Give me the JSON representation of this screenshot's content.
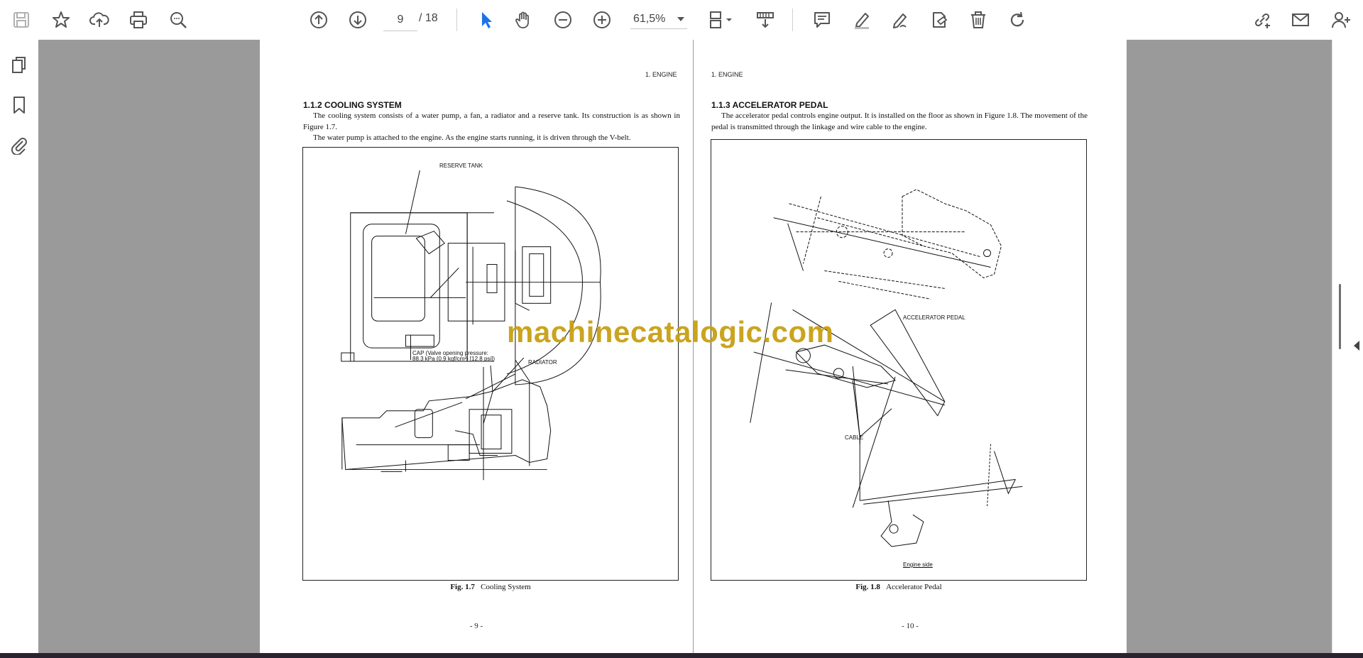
{
  "toolbar": {
    "current_page": "9",
    "page_total": "/ 18",
    "zoom": "61,5%",
    "buttons": [
      "save-icon",
      "bookmark-star-icon",
      "upload-cloud-icon",
      "print-icon",
      "zoom-search-icon",
      "previous-page-icon",
      "next-page-icon",
      "select-cursor-icon",
      "hand-pan-icon",
      "zoom-out-icon",
      "zoom-in-icon",
      "page-fit-icon",
      "scroll-mode-icon",
      "comment-icon",
      "highlight-pen-icon",
      "draw-pen-icon",
      "stamp-tag-icon",
      "delete-icon",
      "redo-icon",
      "share-link-icon",
      "email-icon",
      "add-user-icon"
    ],
    "accent": "#1a73e8"
  },
  "left_rail": {
    "items": [
      "pages-icon",
      "bookmarks-icon",
      "attachments-icon"
    ]
  },
  "watermark": "machinecatalogic.com",
  "pages": [
    {
      "header": "1.  ENGINE",
      "title": "1.1.2  COOLING SYSTEM",
      "para1": "The cooling system consists of a water pump, a fan, a radiator and a reserve tank.  Its construction is as shown in Figure 1.7.",
      "para2": "The water pump is attached to the engine.  As the engine starts running, it is driven through the V-belt.",
      "labels": {
        "reserve_tank": "RESERVE TANK",
        "cap_line1": "CAP (Valve opening pressure:",
        "cap_line2": "88.3 kPa {0.9 kgf/cm²} [12.8 psi])",
        "radiator": "RADIATOR"
      },
      "fig_no": "Fig. 1.7",
      "fig_title": "Cooling System",
      "page_number": "- 9 -"
    },
    {
      "header": "1.  ENGINE",
      "title": "1.1.3  ACCELERATOR PEDAL",
      "para1": "The accelerator pedal controls engine output.  It is installed on the floor as shown in Figure 1.8.  The movement of the pedal is transmitted through the linkage and wire cable to the engine.",
      "labels": {
        "accelerator_pedal": "ACCELERATOR PEDAL",
        "cable": "CABLE",
        "engine_side": "Engine side"
      },
      "fig_no": "Fig. 1.8",
      "fig_title": "Accelerator Pedal",
      "page_number": "- 10 -"
    }
  ]
}
